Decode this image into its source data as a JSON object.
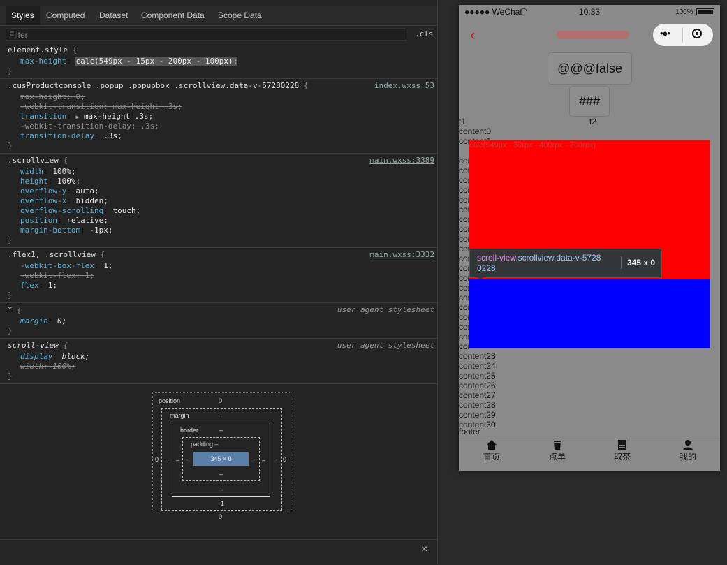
{
  "devtools": {
    "tabs": [
      "Styles",
      "Computed",
      "Dataset",
      "Component Data",
      "Scope Data"
    ],
    "filter_placeholder": "Filter",
    "cls_label": ".cls",
    "rules": [
      {
        "selector": "element.style",
        "source": "",
        "decls": [
          {
            "prop": "max-height",
            "value": "calc(549px - 15px - 200px - 100px);",
            "struck": false
          }
        ]
      },
      {
        "selector": ".cusProductconsole .popup .popupbox .scrollview.data-v-57280228",
        "source": "index.wxss:53",
        "decls": [
          {
            "prop": "max-height",
            "value": "0;",
            "struck": true
          },
          {
            "prop": "-webkit-transition",
            "value": "max-height .3s;",
            "struck": true
          },
          {
            "prop": "transition",
            "value": "max-height .3s;",
            "struck": false
          },
          {
            "prop": "-webkit-transition-delay",
            "value": ".3s;",
            "struck": true
          },
          {
            "prop": "transition-delay",
            "value": ".3s;",
            "struck": false
          }
        ]
      },
      {
        "selector": ".scrollview",
        "source": "main.wxss:3389",
        "decls": [
          {
            "prop": "width",
            "value": "100%;",
            "struck": false
          },
          {
            "prop": "height",
            "value": "100%;",
            "struck": false
          },
          {
            "prop": "overflow-y",
            "value": "auto;",
            "struck": false
          },
          {
            "prop": "overflow-x",
            "value": "hidden;",
            "struck": false
          },
          {
            "prop": "overflow-scrolling",
            "value": "touch;",
            "struck": false
          },
          {
            "prop": "position",
            "value": "relative;",
            "struck": false
          },
          {
            "prop": "margin-bottom",
            "value": "-1px;",
            "struck": false
          }
        ]
      },
      {
        "selector": ".flex1, .scrollview",
        "source": "main.wxss:3332",
        "decls": [
          {
            "prop": "-webkit-box-flex",
            "value": "1;",
            "struck": false
          },
          {
            "prop": "-webkit-flex",
            "value": "1;",
            "struck": true
          },
          {
            "prop": "flex",
            "value": "1;",
            "struck": false
          }
        ]
      },
      {
        "selector": "*",
        "source": "user agent stylesheet",
        "decls": [
          {
            "prop": "margin",
            "value": "0;",
            "struck": false
          }
        ]
      },
      {
        "selector": "scroll-view",
        "source": "user agent stylesheet",
        "decls": [
          {
            "prop": "display",
            "value": "block;",
            "struck": false
          },
          {
            "prop": "width",
            "value": "100%;",
            "struck": true
          }
        ]
      }
    ],
    "boxmodel": {
      "position_label": "position",
      "position_value": "0",
      "margin_label": "margin",
      "margin_value": "–",
      "border_label": "border",
      "border_value": "–",
      "padding_label": "padding –",
      "content": "345 × 0",
      "left_outer": "0",
      "left_margin": "–",
      "left_border": "–",
      "left_padding": "–",
      "right_padding": "–",
      "right_border": "–",
      "right_margin": "–",
      "right_outer": "0",
      "bottom_padding": "–",
      "bottom_border": "–",
      "bottom_margin": "-1",
      "bottom_position": "0"
    },
    "close_label": "×"
  },
  "simulator": {
    "status": {
      "carrier": "●●●●● WeChat",
      "time": "10:33",
      "battery": "100%"
    },
    "buttons": [
      "@@@false",
      "###"
    ],
    "tabs_row": [
      "t1",
      "t2"
    ],
    "scroll_label": "calc(549px - 30rpx - 400rpx - 200rpx)",
    "tooltip": {
      "tag": "scroll-view",
      "classes": ".scrollview.data-v-5728",
      "classes2": "0228",
      "size": "345 x 0"
    },
    "contents_above": [
      "content0",
      "content1"
    ],
    "contents_below": [
      "content23",
      "content24",
      "content25",
      "content26",
      "content27",
      "content28",
      "content29",
      "content30"
    ],
    "footer": "footer",
    "tabbar": [
      "首页",
      "点单",
      "取茶",
      "我的"
    ],
    "colors": {
      "red": "#ff0000",
      "blue": "#0000ff"
    }
  }
}
